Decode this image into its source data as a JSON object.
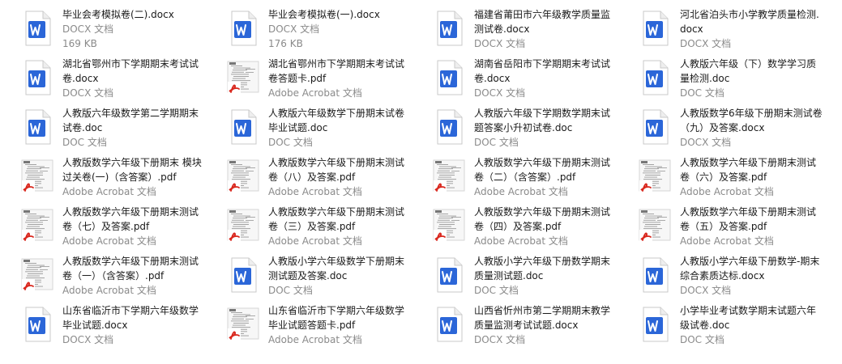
{
  "colors": {
    "word_blue": "#2b66d8",
    "pdf_red": "#d9261c",
    "meta_gray": "#8a8a8a"
  },
  "files": [
    {
      "name": "毕业会考模拟卷(二).docx",
      "type": "DOCX 文档",
      "size": "169 KB",
      "icon": "word-icon"
    },
    {
      "name": "毕业会考模拟卷(一).docx",
      "type": "DOCX 文档",
      "size": "176 KB",
      "icon": "word-icon"
    },
    {
      "name": "福建省莆田市六年级教学质量监测试卷.docx",
      "type": "DOCX 文档",
      "icon": "word-icon"
    },
    {
      "name": "河北省泊头市小学教学质量检测.docx",
      "type": "DOCX 文档",
      "icon": "word-icon"
    },
    {
      "name": "湖北省鄂州市下学期期末考试试卷.docx",
      "type": "DOCX 文档",
      "icon": "word-icon"
    },
    {
      "name": "湖北省鄂州市下学期期末考试试卷答题卡.pdf",
      "type": "Adobe Acrobat 文档",
      "icon": "pdf-thumb-icon"
    },
    {
      "name": "湖南省岳阳市下学期期末考试试卷.docx",
      "type": "DOCX 文档",
      "icon": "word-icon"
    },
    {
      "name": "人教版六年级（下）数学学习质量检测.doc",
      "type": "DOC 文档",
      "icon": "word-icon"
    },
    {
      "name": "人教版六年级数学第二学期期末试卷.doc",
      "type": "DOC 文档",
      "icon": "word-icon"
    },
    {
      "name": "人教版六年级数学下册期末试卷毕业试题.doc",
      "type": "DOC 文档",
      "icon": "word-icon"
    },
    {
      "name": "人教版六年级下学期数学期末试题答案小升初试卷.doc",
      "type": "DOC 文档",
      "icon": "word-icon"
    },
    {
      "name": "人教版数学6年级下册期末测试卷（九）及答案.docx",
      "type": "DOCX 文档",
      "icon": "word-icon"
    },
    {
      "name": "人教版数学六年级下册期末 模块过关卷(一)（含答案）.pdf",
      "type": "Adobe Acrobat 文档",
      "icon": "pdf-thumb-icon"
    },
    {
      "name": "人教版数学六年级下册期末测试卷（八）及答案.pdf",
      "type": "Adobe Acrobat 文档",
      "icon": "pdf-thumb-icon"
    },
    {
      "name": "人教版数学六年级下册期末测试卷（二）（含答案）.pdf",
      "type": "Adobe Acrobat 文档",
      "icon": "pdf-thumb-icon"
    },
    {
      "name": "人教版数学六年级下册期末测试卷（六）及答案.pdf",
      "type": "Adobe Acrobat 文档",
      "icon": "pdf-thumb-icon"
    },
    {
      "name": "人教版数学六年级下册期末测试卷（七）及答案.pdf",
      "type": "Adobe Acrobat 文档",
      "icon": "pdf-thumb-icon"
    },
    {
      "name": "人教版数学六年级下册期末测试卷（三）及答案.pdf",
      "type": "Adobe Acrobat 文档",
      "icon": "pdf-thumb-icon"
    },
    {
      "name": "人教版数学六年级下册期末测试卷（四）及答案.pdf",
      "type": "Adobe Acrobat 文档",
      "icon": "pdf-thumb-icon"
    },
    {
      "name": "人教版数学六年级下册期末测试卷（五）及答案.pdf",
      "type": "Adobe Acrobat 文档",
      "icon": "pdf-thumb-icon"
    },
    {
      "name": "人教版数学六年级下册期末测试卷（一）（含答案）.pdf",
      "type": "Adobe Acrobat 文档",
      "icon": "pdf-thumb-icon"
    },
    {
      "name": "人教版小学六年级数学下册期末测试题及答案.doc",
      "type": "DOC 文档",
      "icon": "word-icon"
    },
    {
      "name": "人教版小学六年级下册数学期末质量测试题.doc",
      "type": "DOC 文档",
      "icon": "word-icon"
    },
    {
      "name": "人教版小学六年级下册数学-期末综合素质达标.docx",
      "type": "DOCX 文档",
      "icon": "word-icon"
    },
    {
      "name": "山东省临沂市下学期六年级数学毕业试题.docx",
      "type": "DOCX 文档",
      "icon": "word-icon"
    },
    {
      "name": "山东省临沂市下学期六年级数学毕业试题答题卡.pdf",
      "type": "Adobe Acrobat 文档",
      "icon": "pdf-thumb-icon"
    },
    {
      "name": "山西省忻州市第二学期期末教学质量监测考试试题.docx",
      "type": "DOCX 文档",
      "icon": "word-icon"
    },
    {
      "name": "小学毕业考试数学期末试题六年级试卷.doc",
      "type": "DOC 文档",
      "icon": "word-icon"
    }
  ]
}
